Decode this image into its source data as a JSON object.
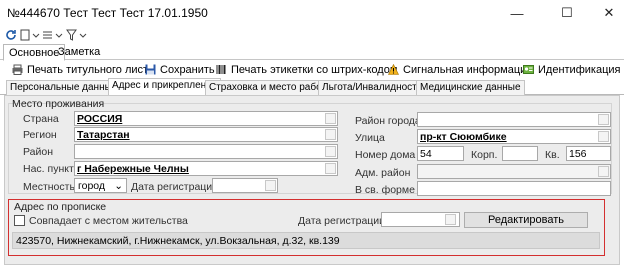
{
  "window": {
    "title": "№444670 Тест Тест Тест 17.01.1950",
    "minimize": "—",
    "maximize": "☐",
    "close": "✕"
  },
  "top_tabs": [
    "Основное",
    "Заметка"
  ],
  "toolbar": {
    "print_title": "Печать титульного листа",
    "save": "Сохранить",
    "print_barcode": "Печать этикетки со штрих-кодом",
    "signal": "Сигнальная информация",
    "ident": "Идентификация"
  },
  "subtabs": [
    "Персональные данные",
    "Адрес и прикрепление",
    "Страховка и место работы",
    "Льгота/Инвалидность",
    "Медицинские данные"
  ],
  "residence": {
    "group_label": "Место проживания",
    "country_label": "Страна",
    "country": "РОССИЯ",
    "region_label": "Регион",
    "region": "Татарстан",
    "district_label": "Район",
    "district": "",
    "settlement_label": "Нас. пункт",
    "settlement": "г Набережные Челны",
    "locality_label": "Местность",
    "locality": "город",
    "reg_date_label": "Дата регистрации",
    "reg_date": "",
    "city_district_label": "Район города",
    "city_district": "",
    "street_label": "Улица",
    "street": "пр-кт Сююмбике",
    "house_label": "Номер дома",
    "house": "54",
    "building_label": "Корп.",
    "building": "",
    "flat_label": "Кв.",
    "flat": "156",
    "adm_district_label": "Адм. район",
    "adm_district": "",
    "military_label": "В св. форме",
    "military": ""
  },
  "registration": {
    "group_label": "Адрес по прописке",
    "same_label": "Совпадает с местом жительства",
    "reg_date_label": "Дата регистрации",
    "reg_date": "",
    "edit_button": "Редактировать",
    "address": "423570, Нижнекамский, г.Нижнекамск, ул.Вокзальная, д.32, кв.139"
  },
  "colors": {
    "highlight": "#d32f2f",
    "panel": "#ececec"
  }
}
